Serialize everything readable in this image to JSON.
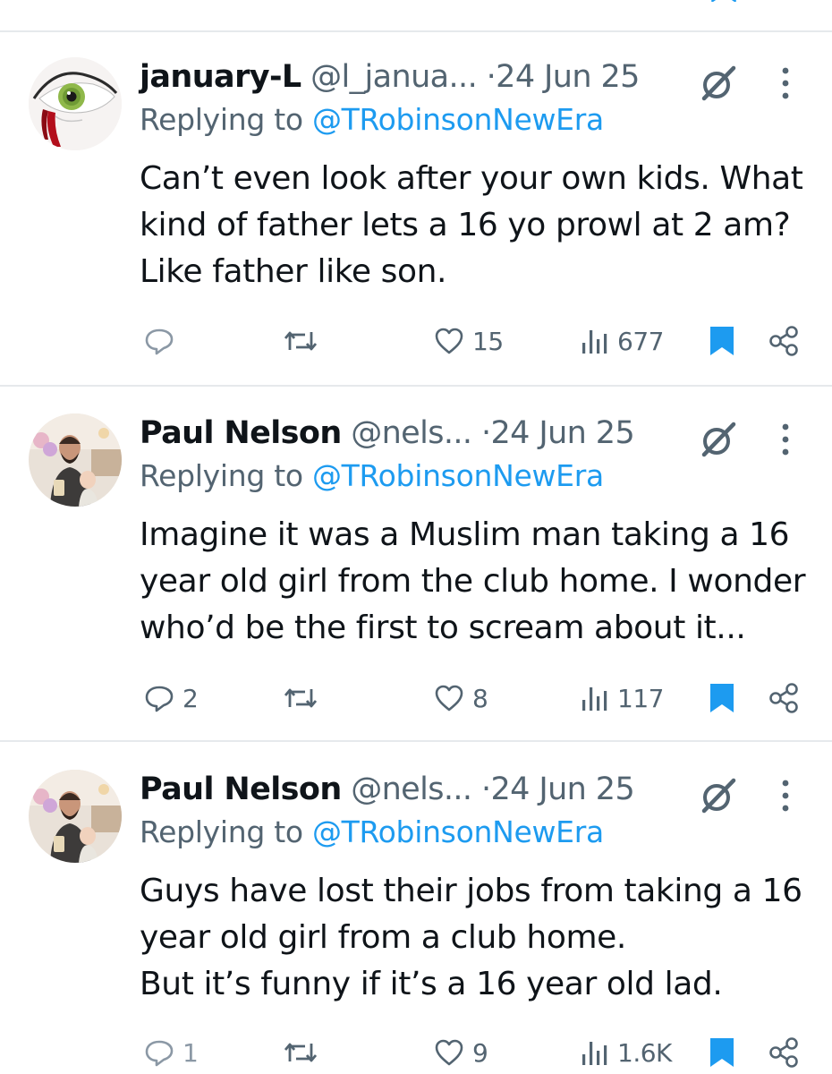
{
  "colors": {
    "accent": "#1d9bf0",
    "text": "#0f1419",
    "muted": "#536471",
    "divider": "#e6e9ec"
  },
  "tweets": [
    {
      "name": "january-L",
      "handle": "@l_janua...",
      "separator": "·",
      "date": "24 Jun 25",
      "replying_prefix": "Replying to",
      "replying_to": "@TRobinsonNewEra",
      "body_lines": [
        "Can’t even look after your own kids. What",
        "kind of father lets a 16 yo prowl at 2 am?",
        "Like father like son."
      ],
      "replies": "",
      "likes": "15",
      "views": "677",
      "avatar_icon": "eye-avatar"
    },
    {
      "name": "Paul Nelson",
      "handle": "@nels...",
      "separator": "·",
      "date": "24 Jun 25",
      "replying_prefix": "Replying to",
      "replying_to": "@TRobinsonNewEra",
      "body_lines": [
        "Imagine it was a Muslim man taking a 16",
        "year old girl from the club home. I wonder",
        "who’d be the first to scream about it..."
      ],
      "replies": "2",
      "likes": "8",
      "views": "117",
      "avatar_icon": "person-photo-avatar"
    },
    {
      "name": "Paul Nelson",
      "handle": "@nels...",
      "separator": "·",
      "date": "24 Jun 25",
      "replying_prefix": "Replying to",
      "replying_to": "@TRobinsonNewEra",
      "body_lines": [
        "Guys have lost their jobs from taking a 16",
        "year old girl from a club home.",
        "But it’s funny if it’s a 16 year old lad."
      ],
      "replies": "1",
      "likes": "9",
      "views": "1.6K",
      "avatar_icon": "person-photo-avatar"
    }
  ]
}
